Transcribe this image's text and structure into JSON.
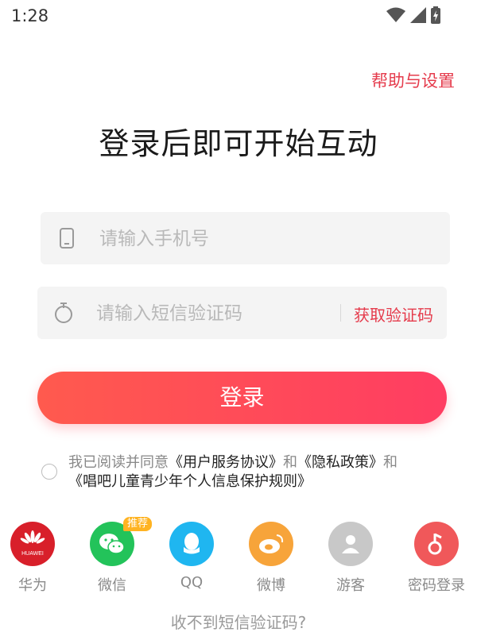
{
  "status_bar": {
    "time": "1:28"
  },
  "header": {
    "help_label": "帮助与设置"
  },
  "main": {
    "title": "登录后即可开始互动",
    "phone": {
      "placeholder": "请输入手机号"
    },
    "sms": {
      "placeholder": "请输入短信验证码",
      "get_code_label": "获取验证码"
    },
    "login_label": "登录",
    "agreement": {
      "prefix": "我已阅读并同意",
      "link1": "《用户服务协议》",
      "and1": "和",
      "link2": "《隐私政策》",
      "and2": "和",
      "link3": "《唱吧儿童青少年个人信息保护规则》"
    }
  },
  "login_options": [
    {
      "label": "华为",
      "icon": "huawei-icon",
      "color": "#d81f2a",
      "logo_text": "HUAWEI"
    },
    {
      "label": "微信",
      "icon": "wechat-icon",
      "color": "#23c35a",
      "badge": "推荐"
    },
    {
      "label": "QQ",
      "icon": "qq-icon",
      "color": "#1fb6f0"
    },
    {
      "label": "微博",
      "icon": "weibo-icon",
      "color": "#f7a43a"
    },
    {
      "label": "游客",
      "icon": "guest-icon",
      "color": "#c8c8c8"
    },
    {
      "label": "密码登录",
      "icon": "password-login-icon",
      "color": "#f0585a"
    }
  ],
  "footer": {
    "no_sms_label": "收不到短信验证码?"
  },
  "colors": {
    "accent": "#e53b4c",
    "button_start": "#ff5a4e",
    "button_end": "#ff3d62"
  }
}
